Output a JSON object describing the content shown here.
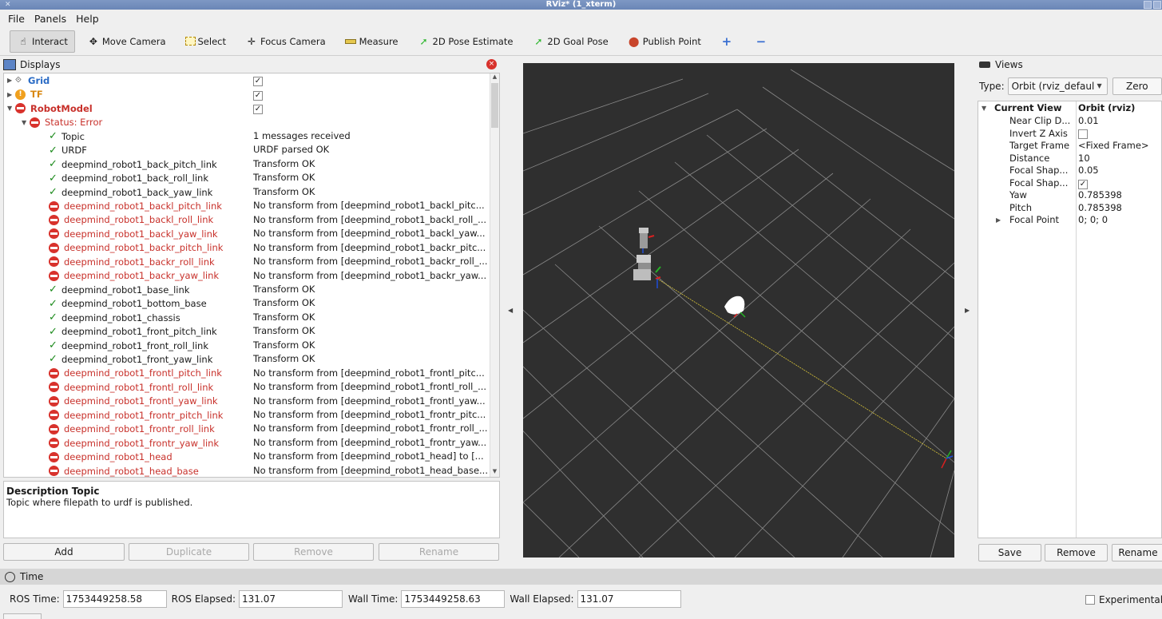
{
  "window": {
    "title": "RViz* (1_xterm)"
  },
  "menu": {
    "file": "File",
    "panels": "Panels",
    "help": "Help"
  },
  "toolbar": {
    "interact": "Interact",
    "move_camera": "Move Camera",
    "select": "Select",
    "focus_camera": "Focus Camera",
    "measure": "Measure",
    "pose_estimate": "2D Pose Estimate",
    "goal_pose": "2D Goal Pose",
    "publish_point": "Publish Point",
    "add_tool": "+",
    "remove_tool": "−"
  },
  "displays": {
    "title": "Displays",
    "grid": "Grid",
    "tf": "TF",
    "robotmodel": "RobotModel",
    "status": "Status: Error",
    "rows": [
      {
        "name": "Topic",
        "value": "1 messages received",
        "ok": true
      },
      {
        "name": "URDF",
        "value": "URDF parsed OK",
        "ok": true
      },
      {
        "name": "deepmind_robot1_back_pitch_link",
        "value": "Transform OK",
        "ok": true
      },
      {
        "name": "deepmind_robot1_back_roll_link",
        "value": "Transform OK",
        "ok": true
      },
      {
        "name": "deepmind_robot1_back_yaw_link",
        "value": "Transform OK",
        "ok": true
      },
      {
        "name": "deepmind_robot1_backl_pitch_link",
        "value": "No transform from [deepmind_robot1_backl_pitc...",
        "ok": false
      },
      {
        "name": "deepmind_robot1_backl_roll_link",
        "value": "No transform from [deepmind_robot1_backl_roll_...",
        "ok": false
      },
      {
        "name": "deepmind_robot1_backl_yaw_link",
        "value": "No transform from [deepmind_robot1_backl_yaw...",
        "ok": false
      },
      {
        "name": "deepmind_robot1_backr_pitch_link",
        "value": "No transform from [deepmind_robot1_backr_pitc...",
        "ok": false
      },
      {
        "name": "deepmind_robot1_backr_roll_link",
        "value": "No transform from [deepmind_robot1_backr_roll_...",
        "ok": false
      },
      {
        "name": "deepmind_robot1_backr_yaw_link",
        "value": "No transform from [deepmind_robot1_backr_yaw...",
        "ok": false
      },
      {
        "name": "deepmind_robot1_base_link",
        "value": "Transform OK",
        "ok": true
      },
      {
        "name": "deepmind_robot1_bottom_base",
        "value": "Transform OK",
        "ok": true
      },
      {
        "name": "deepmind_robot1_chassis",
        "value": "Transform OK",
        "ok": true
      },
      {
        "name": "deepmind_robot1_front_pitch_link",
        "value": "Transform OK",
        "ok": true
      },
      {
        "name": "deepmind_robot1_front_roll_link",
        "value": "Transform OK",
        "ok": true
      },
      {
        "name": "deepmind_robot1_front_yaw_link",
        "value": "Transform OK",
        "ok": true
      },
      {
        "name": "deepmind_robot1_frontl_pitch_link",
        "value": "No transform from [deepmind_robot1_frontl_pitc...",
        "ok": false
      },
      {
        "name": "deepmind_robot1_frontl_roll_link",
        "value": "No transform from [deepmind_robot1_frontl_roll_...",
        "ok": false
      },
      {
        "name": "deepmind_robot1_frontl_yaw_link",
        "value": "No transform from [deepmind_robot1_frontl_yaw...",
        "ok": false
      },
      {
        "name": "deepmind_robot1_frontr_pitch_link",
        "value": "No transform from [deepmind_robot1_frontr_pitc...",
        "ok": false
      },
      {
        "name": "deepmind_robot1_frontr_roll_link",
        "value": "No transform from [deepmind_robot1_frontr_roll_...",
        "ok": false
      },
      {
        "name": "deepmind_robot1_frontr_yaw_link",
        "value": "No transform from [deepmind_robot1_frontr_yaw...",
        "ok": false
      },
      {
        "name": "deepmind_robot1_head",
        "value": "No transform from [deepmind_robot1_head] to [...",
        "ok": false
      },
      {
        "name": "deepmind_robot1_head_base",
        "value": "No transform from [deepmind_robot1_head_base...",
        "ok": false
      }
    ]
  },
  "description": {
    "title": "Description Topic",
    "body": "Topic where filepath to urdf is published."
  },
  "buttons": {
    "add": "Add",
    "duplicate": "Duplicate",
    "remove": "Remove",
    "rename": "Rename"
  },
  "views": {
    "title": "Views",
    "type_label": "Type:",
    "type_value": "Orbit (rviz_defaul",
    "zero": "Zero",
    "current_view": "Current View",
    "current_view_value": "Orbit (rviz)",
    "props": [
      {
        "key": "Near Clip D...",
        "value": "0.01"
      },
      {
        "key": "Invert Z Axis",
        "value": ""
      },
      {
        "key": "Target Frame",
        "value": "<Fixed Frame>"
      },
      {
        "key": "Distance",
        "value": "10"
      },
      {
        "key": "Focal Shap...",
        "value": "0.05"
      },
      {
        "key": "Focal Shap...",
        "value": "✓"
      },
      {
        "key": "Yaw",
        "value": "0.785398"
      },
      {
        "key": "Pitch",
        "value": "0.785398"
      },
      {
        "key": "Focal Point",
        "value": "0; 0; 0"
      }
    ],
    "save": "Save",
    "remove": "Remove",
    "rename": "Rename"
  },
  "time": {
    "title": "Time",
    "ros_time_label": "ROS Time:",
    "ros_time": "1753449258.58",
    "ros_elapsed_label": "ROS Elapsed:",
    "ros_elapsed": "131.07",
    "wall_time_label": "Wall Time:",
    "wall_time": "1753449258.63",
    "wall_elapsed_label": "Wall Elapsed:",
    "wall_elapsed": "131.07",
    "experimental": "Experimental"
  },
  "colors": {
    "error": "#c8312b",
    "ok": "#1b8a1b",
    "viewport_bg": "#2f2f2f",
    "grid_line": "#a8a8a8"
  }
}
